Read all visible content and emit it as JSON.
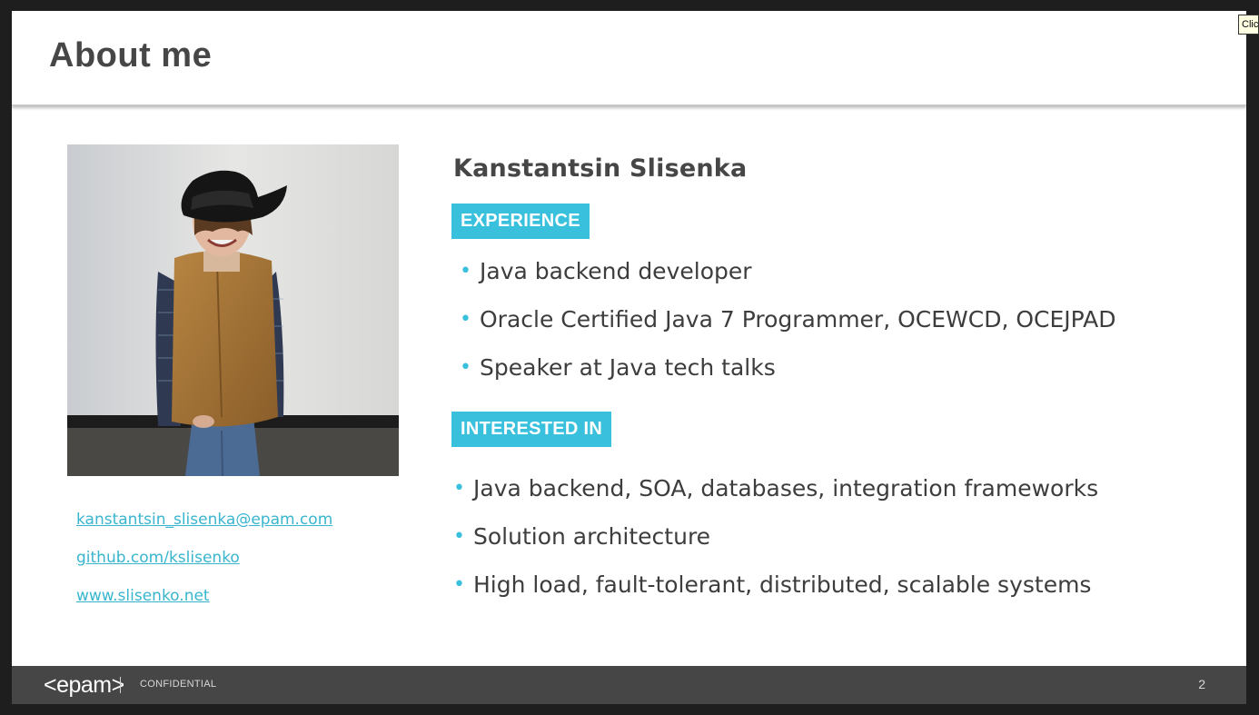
{
  "slide": {
    "title": "About me",
    "name": "Kanstantsin Slisenka",
    "experience_label": "EXPERIENCE",
    "experience": [
      "Java backend developer",
      "Oracle Certified Java 7 Programmer, OCEWCD, OCEJPAD",
      "Speaker at Java tech talks"
    ],
    "interested_label": "INTERESTED IN",
    "interests": [
      "Java backend, SOA, databases, integration frameworks",
      "Solution architecture",
      "High load, fault-tolerant, distributed, scalable systems"
    ],
    "links": {
      "email": "kanstantsin_slisenka@epam.com",
      "github": "github.com/kslisenko",
      "website": "www.slisenko.net"
    },
    "bullet": "•"
  },
  "footer": {
    "logo": "<epam>",
    "confidential": "CONFIDENTIAL",
    "page_number": "2"
  },
  "tooltip": {
    "text": "Click"
  },
  "colors": {
    "accent": "#39c0dc",
    "link": "#39b5cf",
    "title_text": "#464646",
    "footer_bg": "#464646",
    "frame_bg": "#1e1e1e"
  },
  "icons": {
    "photo": "person-photo"
  }
}
